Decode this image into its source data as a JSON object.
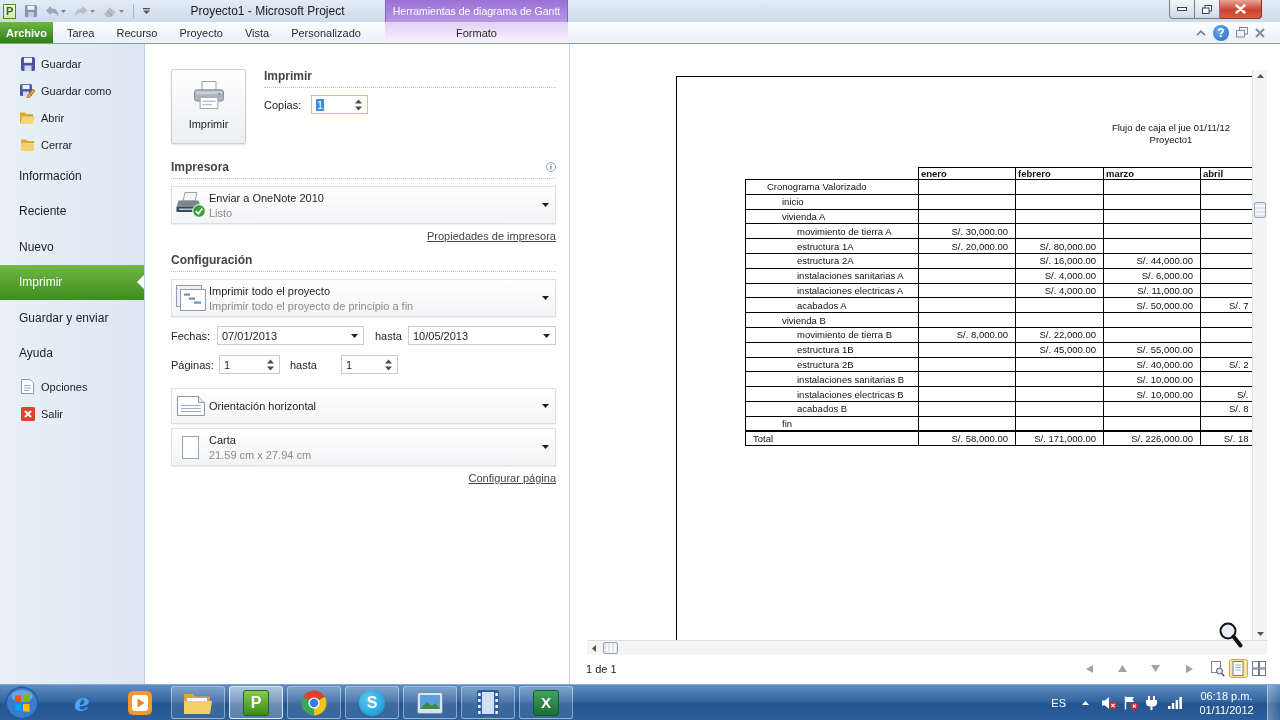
{
  "window": {
    "app_badge": "P",
    "title": "Proyecto1 - Microsoft Project"
  },
  "ribbon": {
    "tabs": [
      {
        "label": "Archivo",
        "selected": true
      },
      {
        "label": "Tarea",
        "selected": false
      },
      {
        "label": "Recurso",
        "selected": false
      },
      {
        "label": "Proyecto",
        "selected": false
      },
      {
        "label": "Vista",
        "selected": false
      },
      {
        "label": "Personalizado",
        "selected": false
      }
    ],
    "contextual_group": {
      "title": "Herramientas de diagrama de Gantt",
      "tabs": [
        {
          "label": "Formato",
          "selected": false
        }
      ]
    },
    "help_button": "?"
  },
  "backstage": {
    "items": [
      {
        "label": "Guardar",
        "kind": "command",
        "selected": false
      },
      {
        "label": "Guardar como",
        "kind": "command",
        "selected": false
      },
      {
        "label": "Abrir",
        "kind": "command",
        "selected": false
      },
      {
        "label": "Cerrar",
        "kind": "command",
        "selected": false
      },
      {
        "label": "Información",
        "kind": "page",
        "selected": false
      },
      {
        "label": "Reciente",
        "kind": "page",
        "selected": false
      },
      {
        "label": "Nuevo",
        "kind": "page",
        "selected": false
      },
      {
        "label": "Imprimir",
        "kind": "page",
        "selected": true
      },
      {
        "label": "Guardar y enviar",
        "kind": "page",
        "selected": false
      },
      {
        "label": "Ayuda",
        "kind": "page",
        "selected": false
      },
      {
        "label": "Opciones",
        "kind": "command",
        "selected": false
      },
      {
        "label": "Salir",
        "kind": "command",
        "selected": false
      }
    ]
  },
  "print": {
    "print_button": "Imprimir",
    "heading": "Imprimir",
    "copies": {
      "label": "Copias:",
      "value": "1",
      "value_selected": true
    },
    "printer": {
      "heading": "Impresora",
      "name": "Enviar a OneNote 2010",
      "status": "Listo",
      "properties_link": "Propiedades de impresora"
    },
    "settings": {
      "heading": "Configuración",
      "scope": {
        "title": "Imprimir todo el proyecto",
        "description": "Imprimir todo el proyecto de principio a fin"
      },
      "dates": {
        "label": "Fechas:",
        "from": "07/01/2013",
        "to_label": "hasta",
        "to": "10/05/2013"
      },
      "pages": {
        "label": "Páginas:",
        "from": "1",
        "to_label": "hasta",
        "to": "1"
      },
      "orientation": {
        "title": "Orientación horizontal"
      },
      "paper": {
        "title": "Carta",
        "description": "21.59 cm x 27.94 cm"
      },
      "page_setup_link": "Configurar página"
    }
  },
  "preview": {
    "report_title": "Flujo de caja el jue 01/11/12",
    "project_name": "Proyecto1",
    "table": {
      "columns": [
        "enero",
        "febrero",
        "marzo",
        "abril"
      ],
      "rows": [
        {
          "label": "Cronograma Valorizado",
          "children": [
            {
              "label": "inicio"
            },
            {
              "label": "vivienda A",
              "children": [
                {
                  "label": "movimiento de tierra A",
                  "cells": [
                    "S/. 30,000.00",
                    null,
                    null,
                    null
                  ]
                },
                {
                  "label": "estructura 1A",
                  "cells": [
                    "S/. 20,000.00",
                    "S/. 80,000.00",
                    null,
                    null
                  ]
                },
                {
                  "label": "estructura 2A",
                  "cells": [
                    null,
                    "S/. 16,000.00",
                    "S/. 44,000.00",
                    null
                  ]
                },
                {
                  "label": "instalaciones sanitarias A",
                  "cells": [
                    null,
                    "S/. 4,000.00",
                    "S/. 6,000.00",
                    null
                  ]
                },
                {
                  "label": "instalaciones electricas A",
                  "cells": [
                    null,
                    "S/. 4,000.00",
                    "S/. 11,000.00",
                    null
                  ]
                },
                {
                  "label": "acabados A",
                  "cells": [
                    null,
                    null,
                    "S/. 50,000.00",
                    "S/. 7"
                  ]
                }
              ]
            },
            {
              "label": "vivienda B",
              "children": [
                {
                  "label": "movimiento de tierra B",
                  "cells": [
                    "S/. 8,000.00",
                    "S/. 22,000.00",
                    null,
                    null
                  ]
                },
                {
                  "label": "estructura 1B",
                  "cells": [
                    null,
                    "S/. 45,000.00",
                    "S/. 55,000.00",
                    null
                  ]
                },
                {
                  "label": "estructura 2B",
                  "cells": [
                    null,
                    null,
                    "S/. 40,000.00",
                    "S/. 2"
                  ]
                },
                {
                  "label": "instalaciones sanitarias B",
                  "cells": [
                    null,
                    null,
                    "S/. 10,000.00",
                    null
                  ]
                },
                {
                  "label": "instalaciones electricas B",
                  "cells": [
                    null,
                    null,
                    "S/. 10,000.00",
                    "S/."
                  ]
                },
                {
                  "label": "acabados B",
                  "cells": [
                    null,
                    null,
                    null,
                    "S/. 8"
                  ]
                }
              ]
            },
            {
              "label": "fin"
            }
          ]
        }
      ],
      "total": {
        "label": "Total",
        "cells": [
          "S/. 58,000.00",
          "S/. 171,000.00",
          "S/. 226,000.00",
          "S/. 18"
        ]
      }
    },
    "page_indicator": "1 de 1",
    "zoom_modes": [
      {
        "selected": false
      },
      {
        "selected": true
      },
      {
        "selected": false
      }
    ]
  },
  "taskbar": {
    "apps": [
      {
        "kind": "browser",
        "badge": "e",
        "running": false,
        "selected": false
      },
      {
        "kind": "player",
        "running": false,
        "selected": false
      },
      {
        "kind": "folder",
        "running": true,
        "selected": false
      },
      {
        "kind": "planner",
        "badge": "P",
        "running": true,
        "selected": true
      },
      {
        "kind": "web",
        "running": true,
        "selected": false
      },
      {
        "kind": "chat",
        "badge": "S",
        "running": true,
        "selected": false
      },
      {
        "kind": "viewer",
        "running": true,
        "selected": false
      },
      {
        "kind": "video",
        "running": true,
        "selected": false
      },
      {
        "kind": "sheet",
        "badge": "X",
        "running": true,
        "selected": false
      }
    ],
    "language": "ES",
    "time": "06:18 p.m.",
    "date": "01/11/2012"
  }
}
